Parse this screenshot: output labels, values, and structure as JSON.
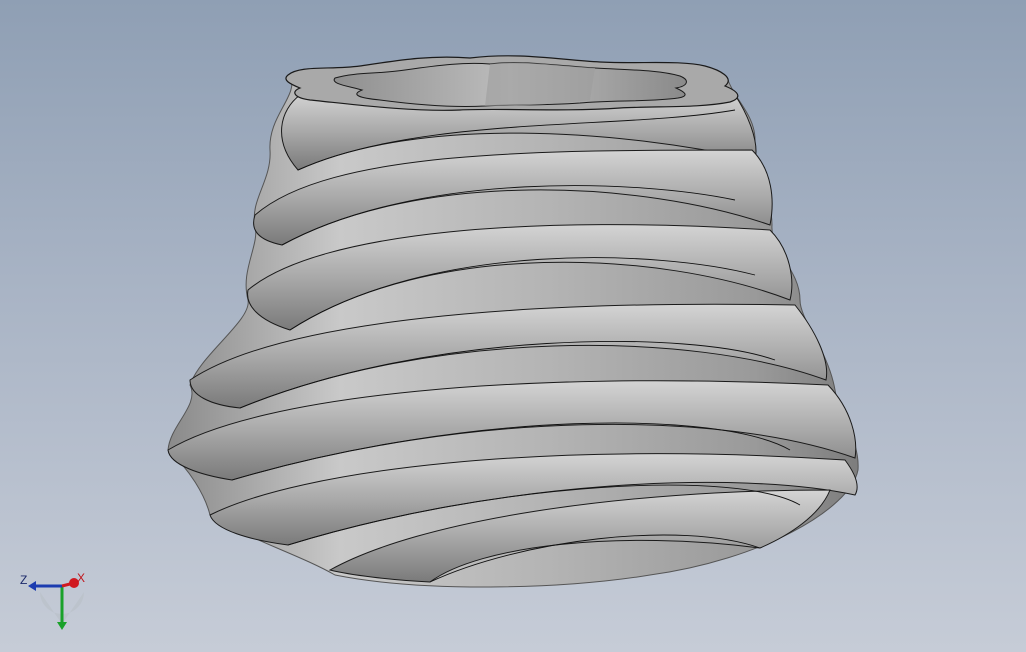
{
  "viewport": {
    "background_top": "#8f9fb4",
    "background_bottom": "#c6ccd7",
    "model": {
      "description_icon": "twisted-helical-vase-model",
      "surface_color": "#a5a5a5",
      "edge_color": "#1a1a1a"
    },
    "triad": {
      "icon": "axis-triad-icon",
      "z_label": "Z",
      "x_label": "X",
      "z_color": "#1c3cb0",
      "x_color": "#d0181f",
      "y_color": "#1aa12a"
    }
  }
}
